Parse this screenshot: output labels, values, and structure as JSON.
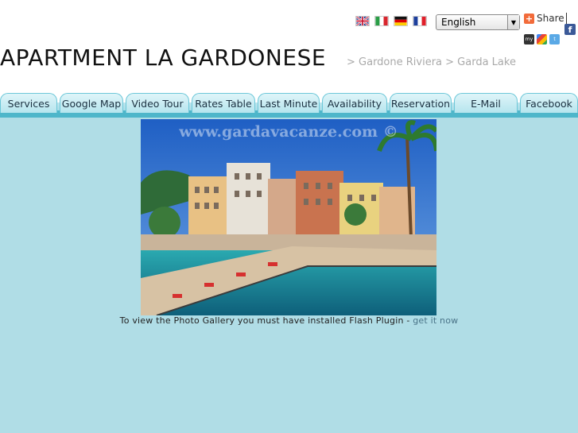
{
  "header": {
    "site_title": "APARTMENT LA GARDONESE",
    "breadcrumb": "> Gardone Riviera > Garda Lake"
  },
  "languages": {
    "flags": [
      "en",
      "it",
      "de",
      "fr"
    ],
    "selected": "English"
  },
  "share": {
    "label": "Share"
  },
  "nav": {
    "tabs": [
      {
        "label": "Services"
      },
      {
        "label": "Google Map"
      },
      {
        "label": "Video Tour"
      },
      {
        "label": "Rates Table"
      },
      {
        "label": "Last Minute"
      },
      {
        "label": "Availability"
      },
      {
        "label": "Reservation"
      },
      {
        "label": "E-Mail"
      },
      {
        "label": "Facebook"
      }
    ]
  },
  "gallery": {
    "watermark": "www.gardavacanze.com ©",
    "flash_message": "To view the Photo Gallery you must have installed Flash Plugin -",
    "flash_link": "get it now"
  },
  "colors": {
    "nav_tab_bg": "#c9ecf3",
    "main_bg": "#b0dde6",
    "breadcrumb": "#a9a9a9"
  }
}
